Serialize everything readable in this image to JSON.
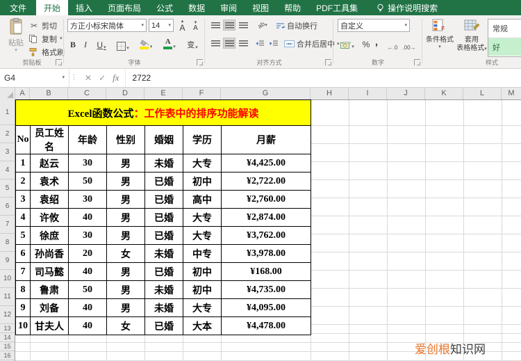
{
  "colors": {
    "excel_green": "#217346",
    "title_row_bg": "#FFFF00",
    "title_red_text": "#FF0000",
    "salary_red": "#FF0000",
    "salary_green": "#00B050",
    "style_good_bg": "#C6EFCE",
    "watermark_orange": "#E8762C"
  },
  "titlebar": {
    "tabs": [
      "文件",
      "开始",
      "插入",
      "页面布局",
      "公式",
      "数据",
      "审阅",
      "视图",
      "帮助",
      "PDF工具集"
    ],
    "search_label": "操作说明搜索"
  },
  "ribbon": {
    "clipboard": {
      "group_label": "剪贴板",
      "paste": "粘贴",
      "cut": "剪切",
      "copy": "复制",
      "format_painter": "格式刷"
    },
    "font": {
      "group_label": "字体",
      "font_name": "方正小标宋简体",
      "font_size": "14",
      "bold": "B",
      "italic": "I",
      "underline": "U",
      "phonetic": "变",
      "grow": "A",
      "shrink": "A"
    },
    "alignment": {
      "group_label": "对齐方式",
      "orientation": "ab",
      "wrap_text": "自动换行",
      "merge_center": "合并后居中"
    },
    "number": {
      "group_label": "数字",
      "number_format": "自定义",
      "percent": "%",
      "comma": ",",
      "inc_decimal": "←.0",
      "dec_decimal": ".00→"
    },
    "styles": {
      "group_label": "样式",
      "conditional_formatting": "条件格式",
      "format_as_table_1": "套用",
      "format_as_table_2": "表格格式",
      "cell_style_normal": "常规",
      "cell_style_good": "好"
    }
  },
  "formula_bar": {
    "name_box": "G4",
    "fx_label": "fx",
    "value": "2722"
  },
  "grid": {
    "columns": [
      "A",
      "B",
      "C",
      "D",
      "E",
      "F",
      "G",
      "H",
      "I",
      "J",
      "K",
      "L",
      "M"
    ],
    "rows": [
      "1",
      "2",
      "3",
      "4",
      "5",
      "6",
      "7",
      "8",
      "9",
      "10",
      "11",
      "12",
      "13",
      "14",
      "15",
      "16"
    ]
  },
  "table": {
    "title_black": "Excel函数公式",
    "title_red": "：工作表中的排序功能解读",
    "headers": [
      "No",
      "员工姓名",
      "年龄",
      "性别",
      "婚姻",
      "学历",
      "月薪"
    ],
    "rows": [
      {
        "no": "1",
        "name": "赵云",
        "age": "30",
        "gender": "男",
        "marital": "未婚",
        "education": "大专",
        "salary": "¥4,425.00",
        "salary_color": "red"
      },
      {
        "no": "2",
        "name": "袁术",
        "age": "50",
        "gender": "男",
        "marital": "已婚",
        "education": "初中",
        "salary": "¥2,722.00",
        "salary_color": "green"
      },
      {
        "no": "3",
        "name": "袁绍",
        "age": "30",
        "gender": "男",
        "marital": "已婚",
        "education": "高中",
        "salary": "¥2,760.00",
        "salary_color": "red"
      },
      {
        "no": "4",
        "name": "许攸",
        "age": "40",
        "gender": "男",
        "marital": "已婚",
        "education": "大专",
        "salary": "¥2,874.00",
        "salary_color": "green"
      },
      {
        "no": "5",
        "name": "徐庶",
        "age": "30",
        "gender": "男",
        "marital": "已婚",
        "education": "大专",
        "salary": "¥3,762.00",
        "salary_color": "red"
      },
      {
        "no": "6",
        "name": "孙尚香",
        "age": "20",
        "gender": "女",
        "marital": "未婚",
        "education": "中专",
        "salary": "¥3,978.00",
        "salary_color": "green"
      },
      {
        "no": "7",
        "name": "司马懿",
        "age": "40",
        "gender": "男",
        "marital": "已婚",
        "education": "初中",
        "salary": "¥168.00",
        "salary_color": "red"
      },
      {
        "no": "8",
        "name": "鲁肃",
        "age": "50",
        "gender": "男",
        "marital": "未婚",
        "education": "初中",
        "salary": "¥4,735.00",
        "salary_color": "green"
      },
      {
        "no": "9",
        "name": "刘备",
        "age": "40",
        "gender": "男",
        "marital": "未婚",
        "education": "大专",
        "salary": "¥4,095.00",
        "salary_color": "red"
      },
      {
        "no": "10",
        "name": "甘夫人",
        "age": "40",
        "gender": "女",
        "marital": "已婚",
        "education": "大本",
        "salary": "¥4,478.00",
        "salary_color": "green"
      }
    ]
  },
  "watermark": {
    "orange_part": "爱创根",
    "dark_part": "知识网"
  }
}
